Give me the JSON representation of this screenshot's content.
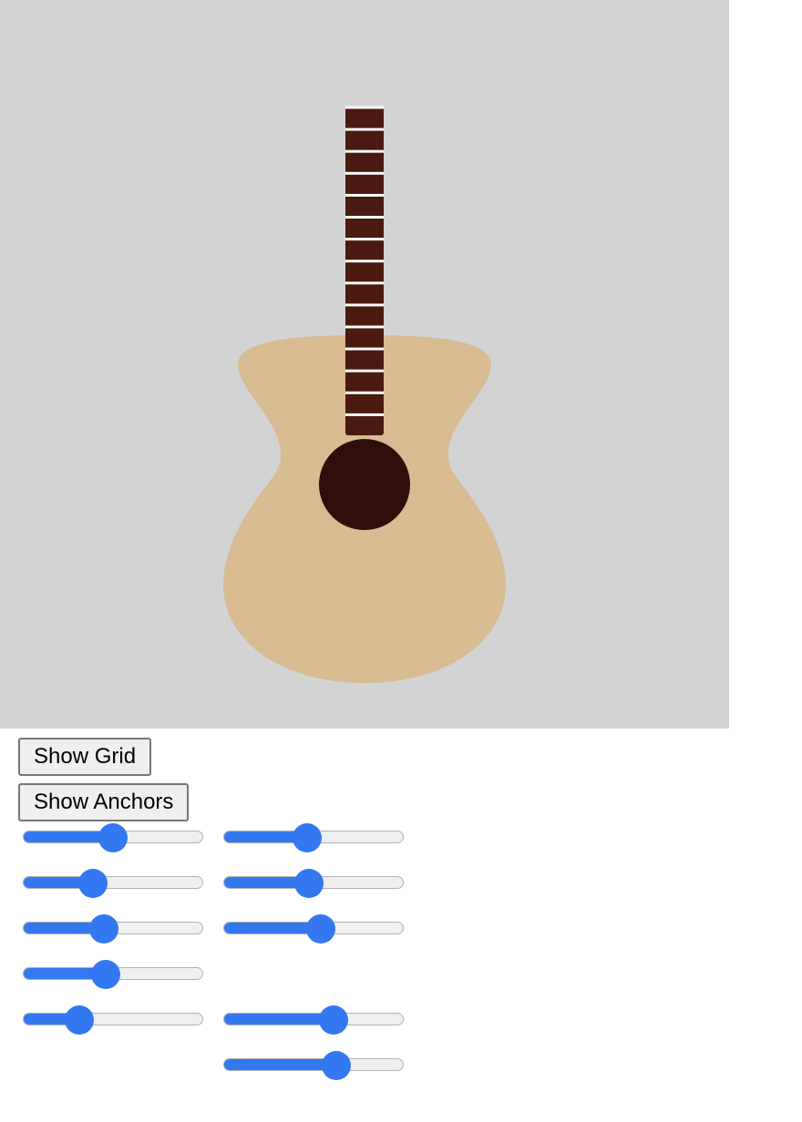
{
  "canvas": {
    "background": "#d3d3d3",
    "guitar": {
      "body_color": "#d8bb91",
      "neck_color": "#4a1a10",
      "fret_color": "#ffffff",
      "soundhole_color": "#2f0f0a",
      "fret_count": 15
    }
  },
  "buttons": {
    "show_grid": "Show Grid",
    "show_anchors": "Show Anchors"
  },
  "sliders": [
    {
      "id": "s-l1",
      "value": 0.5
    },
    {
      "id": "s-r1",
      "value": 0.46
    },
    {
      "id": "s-l2",
      "value": 0.37
    },
    {
      "id": "s-r2",
      "value": 0.47
    },
    {
      "id": "s-l3",
      "value": 0.44
    },
    {
      "id": "s-r3",
      "value": 0.55
    },
    {
      "id": "s-l4",
      "value": 0.45
    },
    {
      "id": "s-l5",
      "value": 0.28
    },
    {
      "id": "s-r5",
      "value": 0.63
    },
    {
      "id": "s-r6",
      "value": 0.65
    }
  ],
  "accent_color": "#3478f1"
}
